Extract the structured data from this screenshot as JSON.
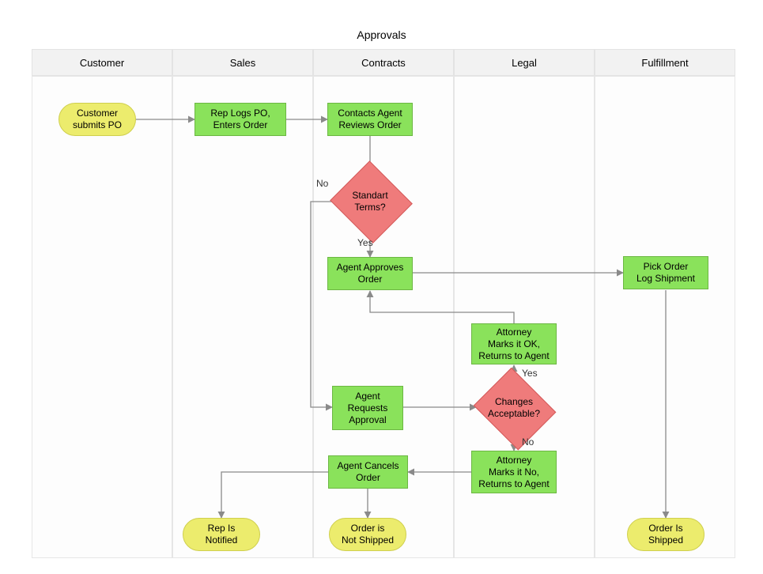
{
  "title": "Approvals",
  "lanes": {
    "customer": "Customer",
    "sales": "Sales",
    "contracts": "Contracts",
    "legal": "Legal",
    "fulfillment": "Fulfillment"
  },
  "nodes": {
    "customer_submits_po": "Customer\nsubmits PO",
    "rep_logs_po": "Rep Logs PO,\nEnters Order",
    "contacts_agent_reviews": "Contacts Agent\nReviews Order",
    "standard_terms": "Standart Terms?",
    "agent_approves_order": "Agent Approves\nOrder",
    "agent_requests_approval": "Agent\nRequests\nApproval",
    "agent_cancels_order": "Agent Cancels\nOrder",
    "attorney_marks_ok": "Attorney\nMarks it OK,\nReturns to Agent",
    "changes_acceptable": "Changes\nAcceptable?",
    "attorney_marks_no": "Attorney\nMarks it No,\nReturns to Agent",
    "pick_order_log_shipment": "Pick Order\nLog Shipment",
    "rep_is_notified": "Rep Is\nNotified",
    "order_not_shipped": "Order is\nNot Shipped",
    "order_is_shipped": "Order Is\nShipped"
  },
  "edge_labels": {
    "standard_terms_yes": "Yes",
    "standard_terms_no": "No",
    "changes_acceptable_yes": "Yes",
    "changes_acceptable_no": "No"
  },
  "colors": {
    "process_fill": "#8ae25b",
    "decision_fill": "#ef7b7b",
    "terminator_fill": "#ecec6d",
    "lane_header_fill": "#f2f2f2"
  }
}
